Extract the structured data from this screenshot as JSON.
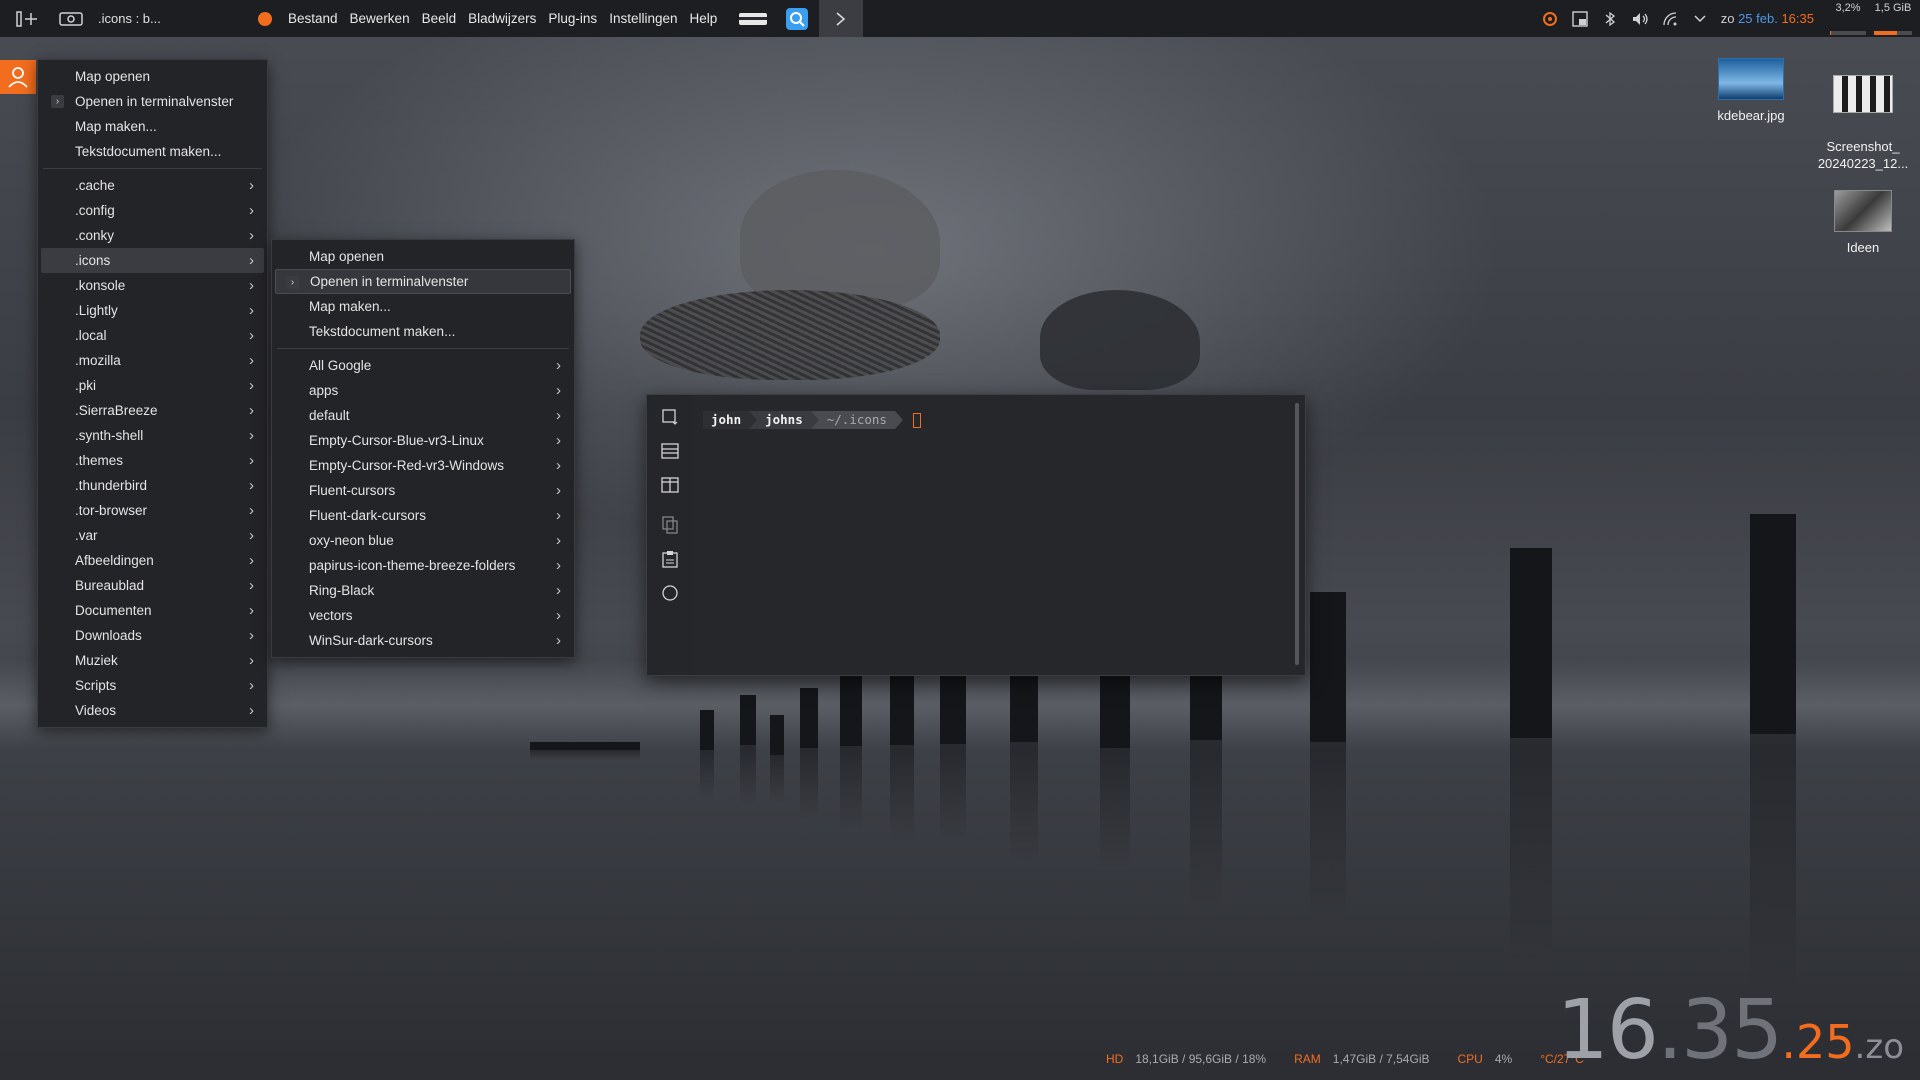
{
  "topbar": {
    "window_title": ".icons : b...",
    "menu": [
      "Bestand",
      "Bewerken",
      "Beeld",
      "Bladwijzers",
      "Plug-ins",
      "Instellingen",
      "Help"
    ],
    "clock": {
      "day": "zo",
      "date": "25 feb.",
      "time": "16:35"
    },
    "cpu_meter": {
      "label": "3,2%",
      "value": 0.032
    },
    "mem_meter": {
      "label": "1,5 GiB",
      "value": 0.6
    },
    "accent": "#f36d1e"
  },
  "main_menu": {
    "actions": [
      "Map openen",
      "Openen in terminalvenster",
      "Map maken...",
      "Tekstdocument maken..."
    ],
    "folders": [
      ".cache",
      ".config",
      ".conky",
      ".icons",
      ".konsole",
      ".Lightly",
      ".local",
      ".mozilla",
      ".pki",
      ".SierraBreeze",
      ".synth-shell",
      ".themes",
      ".thunderbird",
      ".tor-browser",
      ".var",
      "Afbeeldingen",
      "Bureaublad",
      "Documenten",
      "Downloads",
      "Muziek",
      "Scripts",
      "Videos"
    ],
    "active_folder": ".icons"
  },
  "submenu": {
    "actions": [
      "Map openen",
      "Openen in terminalvenster",
      "Map maken...",
      "Tekstdocument maken..."
    ],
    "folders": [
      "All Google",
      "apps",
      "default",
      "Empty-Cursor-Blue-vr3-Linux",
      "Empty-Cursor-Red-vr3-Windows",
      "Fluent-cursors",
      "Fluent-dark-cursors",
      "oxy-neon blue",
      "papirus-icon-theme-breeze-folders",
      "Ring-Black",
      "vectors",
      "WinSur-dark-cursors"
    ],
    "highlighted": "Openen in terminalvenster"
  },
  "terminal": {
    "prompt_user": "john",
    "prompt_host": "johns",
    "prompt_path": "~/.icons"
  },
  "desktop_icons": [
    {
      "name": "kdebear.jpg"
    },
    {
      "name": "Screenshot_\n20240223_12..."
    },
    {
      "name": "Ideen"
    }
  ],
  "stats": {
    "hd_label": "HD",
    "hd_value": "18,1GiB / 95,6GiB / 18%",
    "ram_label": "RAM",
    "ram_value": "1,47GiB / 7,54GiB",
    "cpu_label": "CPU",
    "cpu_value": "4%",
    "temp_value": "°C/27°C"
  },
  "big_clock": {
    "hour": "16",
    "minute": "35",
    "second": "25",
    "day": "zo",
    "sep1": ".",
    "sep2": ".",
    "sep3": "."
  }
}
